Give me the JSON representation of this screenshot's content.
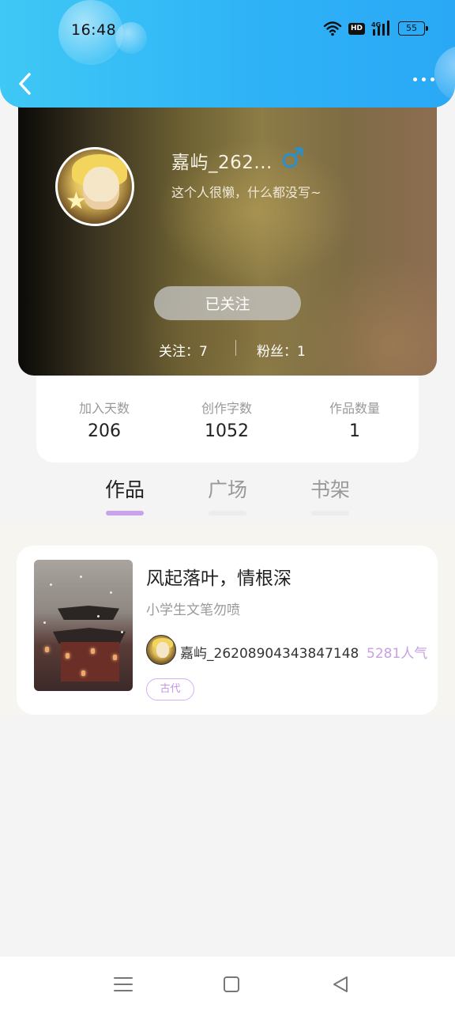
{
  "status_bar": {
    "time": "16:48",
    "hd_label": "HD",
    "network_label": "4G",
    "battery": "55"
  },
  "header": {
    "back_icon": "chevron-left-icon",
    "more_icon": "more-horizontal-icon"
  },
  "profile": {
    "username": "嘉屿_262...",
    "gender_icon": "male-icon",
    "bio": "这个人很懒，什么都没写~",
    "follow_button_label": "已关注",
    "following_text": "关注：7",
    "fans_text": "粉丝：1"
  },
  "stats": [
    {
      "label": "加入天数",
      "value": "206"
    },
    {
      "label": "创作字数",
      "value": "1052"
    },
    {
      "label": "作品数量",
      "value": "1"
    }
  ],
  "tabs": [
    {
      "label": "作品",
      "active": true
    },
    {
      "label": "广场",
      "active": false
    },
    {
      "label": "书架",
      "active": false
    }
  ],
  "works": [
    {
      "title": "风起落叶，情根深",
      "description": "小学生文笔勿喷",
      "author": "嘉屿_26208904343847148",
      "popularity": "5281人气",
      "tag": "古代"
    }
  ],
  "colors": {
    "header_blue": "#2fb3f6",
    "accent_purple": "#c9a3ea",
    "gender_blue": "#2a8fcf"
  },
  "bottom_nav": {
    "menu_icon": "menu-icon",
    "home_icon": "square-home-icon",
    "back_icon": "triangle-back-icon"
  }
}
